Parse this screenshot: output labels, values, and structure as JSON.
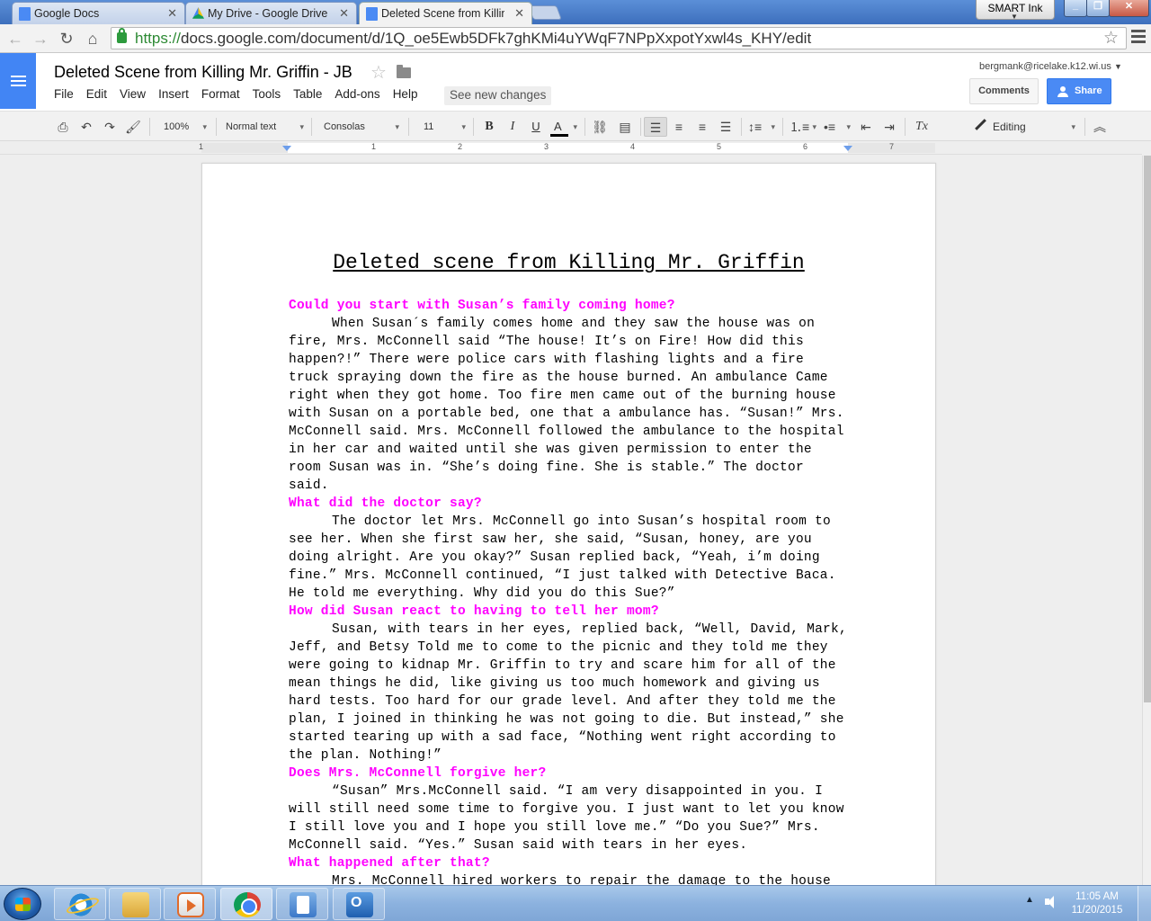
{
  "browser": {
    "tabs": [
      {
        "title": "Google Docs",
        "active": false
      },
      {
        "title": "My Drive - Google Drive",
        "active": false
      },
      {
        "title": "Deleted Scene from Killing",
        "active": true
      }
    ],
    "smart_ink_label": "SMART Ink",
    "url_protocol": "https://",
    "url_rest": "docs.google.com/document/d/1Q_oe5Ewb5DFk7ghKMi4uYWqF7NPpXxpotYxwl4s_KHY/edit"
  },
  "docs": {
    "title": "Deleted Scene from Killing Mr. Griffin - JB",
    "menu": [
      "File",
      "Edit",
      "View",
      "Insert",
      "Format",
      "Tools",
      "Table",
      "Add-ons",
      "Help"
    ],
    "see_changes": "See new changes",
    "account": "bergmank@ricelake.k12.wi.us",
    "comments_label": "Comments",
    "share_label": "Share",
    "colors": {
      "accent": "#4285f4",
      "question": "#ff00ff",
      "share": "#4a8af4"
    }
  },
  "toolbar": {
    "zoom": "100%",
    "style": "Normal text",
    "font": "Consolas",
    "size": "11",
    "bold": "B",
    "italic": "I",
    "underline": "U",
    "text_color": "A",
    "clear_format": "Tx",
    "mode": "Editing",
    "icons": [
      "print-icon",
      "undo-icon",
      "redo-icon",
      "paint-format-icon",
      "link-icon",
      "comment-icon",
      "align-left-icon",
      "align-center-icon",
      "align-right-icon",
      "justify-icon",
      "line-spacing-icon",
      "numbered-list-icon",
      "bulleted-list-icon",
      "decrease-indent-icon",
      "increase-indent-icon",
      "clear-formatting-icon",
      "pencil-icon",
      "collapse-icon"
    ]
  },
  "ruler": {
    "numbers": [
      "1",
      "1",
      "2",
      "3",
      "4",
      "5",
      "6",
      "7"
    ]
  },
  "document": {
    "heading": "Deleted scene from Killing Mr. Griffin",
    "blocks": [
      {
        "type": "question",
        "text": "Could you start with Susan’s family coming home?"
      },
      {
        "type": "para",
        "text": "When Susan´s family comes home and they saw the house was on fire, Mrs. McConnell said “The house! It’s on Fire! How did this happen?!” There were police cars with flashing lights and a fire truck spraying down the fire as the house burned. An ambulance Came right when they got home. Too fire men came out of the burning house with Susan on a portable bed, one that a ambulance has. “Susan!” Mrs. McConnell said. Mrs. McConnell followed the ambulance to the hospital in her car and waited until she was given permission to enter the room Susan was in. “She’s doing fine. She is stable.” The doctor said."
      },
      {
        "type": "question",
        "text": "What did the doctor say?"
      },
      {
        "type": "para",
        "text": "The doctor let Mrs. McConnell go into Susan’s hospital room to see her. When she first saw her, she said, “Susan, honey, are you doing alright. Are you okay?” Susan replied back, “Yeah, i’m doing fine.” Mrs. McConnell continued, “I just talked with Detective Baca. He told me everything. Why did you do this Sue?”"
      },
      {
        "type": "question",
        "text": "How did Susan react to having to tell her mom?"
      },
      {
        "type": "para",
        "text": "Susan, with tears in her eyes, replied back, “Well, David, Mark, Jeff, and Betsy Told me to come to the picnic and they told me they were going to kidnap Mr. Griffin to try and scare him for all of the mean things he did, like giving us too much homework and giving us hard tests. Too hard for our grade level. And after they told me the plan, I joined in thinking he was not going to die. But instead,” she started tearing up with a sad face, “Nothing went right according to the plan. Nothing!”"
      },
      {
        "type": "question",
        "text": "Does Mrs. McConnell forgive her?"
      },
      {
        "type": "para",
        "text": "“Susan” Mrs.McConnell said. “I am very disappointed in you. I will still need some time to forgive you. I just want to let you know I still love you and I hope you still love me.” “Do you Sue?” Mrs. McConnell said. “Yes.” Susan said with tears in her eyes."
      },
      {
        "type": "question",
        "text": "What happened after that?"
      },
      {
        "type": "para",
        "text": "Mrs. McConnell hired workers to repair the damage to the house and when the damage was repaired, she bought new furniture. She went back to the hospital to pick up Susan. Police arrested Mark and he went to court."
      }
    ]
  },
  "taskbar": {
    "apps": [
      "Internet Explorer",
      "Windows Explorer",
      "Windows Media Player",
      "Google Chrome",
      "SMART Notebook",
      "Microsoft Outlook"
    ],
    "time": "11:05 AM",
    "date": "11/20/2015"
  }
}
